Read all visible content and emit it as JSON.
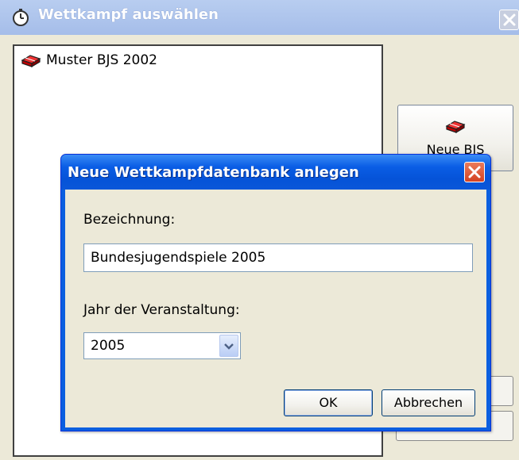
{
  "window": {
    "title": "Wettkampf auswählen",
    "title_icon": "stopwatch-icon"
  },
  "list": {
    "items": [
      {
        "label": "Muster BJS 2002",
        "icon": "database-stack-icon"
      }
    ]
  },
  "toolbar": {
    "new_button_label_first": "N",
    "new_button_label_rest": "eue BJS",
    "new_button_icon": "database-stack-icon"
  },
  "dialog": {
    "title": "Neue Wettkampfdatenbank anlegen",
    "bezeichnung_label": "Bezeichnung:",
    "bezeichnung_value": "Bundesjugendspiele 2005",
    "jahr_label": "Jahr der Veranstaltung:",
    "jahr_value": "2005",
    "ok_label": "OK",
    "cancel_label": "Abbrechen"
  },
  "colors": {
    "dialog_title_blue": "#0A5DE5",
    "close_red": "#D44222",
    "face": "#ECE9D8"
  }
}
